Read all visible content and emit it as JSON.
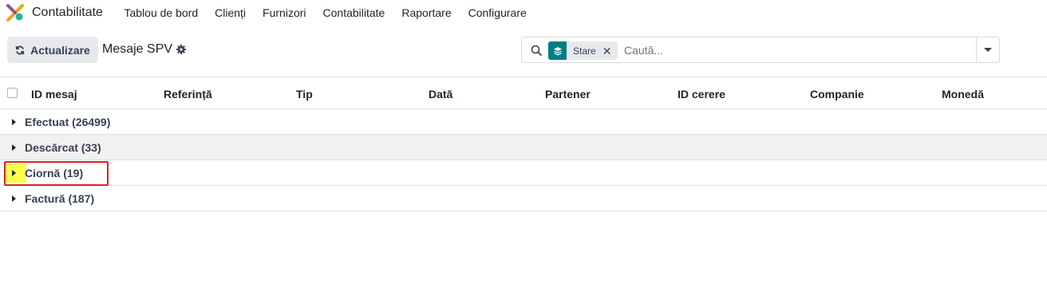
{
  "app": {
    "name": "Contabilitate",
    "logo_icon": "odoo-accounting-logo-icon"
  },
  "menu": [
    "Tablou de bord",
    "Clienți",
    "Furnizori",
    "Contabilitate",
    "Raportare",
    "Configurare"
  ],
  "control": {
    "refresh_label": "Actualizare",
    "page_title": "Mesaje SPV"
  },
  "search": {
    "facet_label": "Stare",
    "facet_remove": "✕",
    "placeholder": "Caută..."
  },
  "columns": [
    "ID mesaj",
    "Referință",
    "Tip",
    "Dată",
    "Partener",
    "ID cerere",
    "Companie",
    "Monedă"
  ],
  "groups": [
    {
      "label": "Efectuat (26499)"
    },
    {
      "label": "Descărcat (33)"
    },
    {
      "label": "Ciornă (19)"
    },
    {
      "label": "Factură (187)"
    }
  ],
  "colors": {
    "accent": "#017e84",
    "highlight": "#fbff4d",
    "annotation": "#e02020"
  }
}
